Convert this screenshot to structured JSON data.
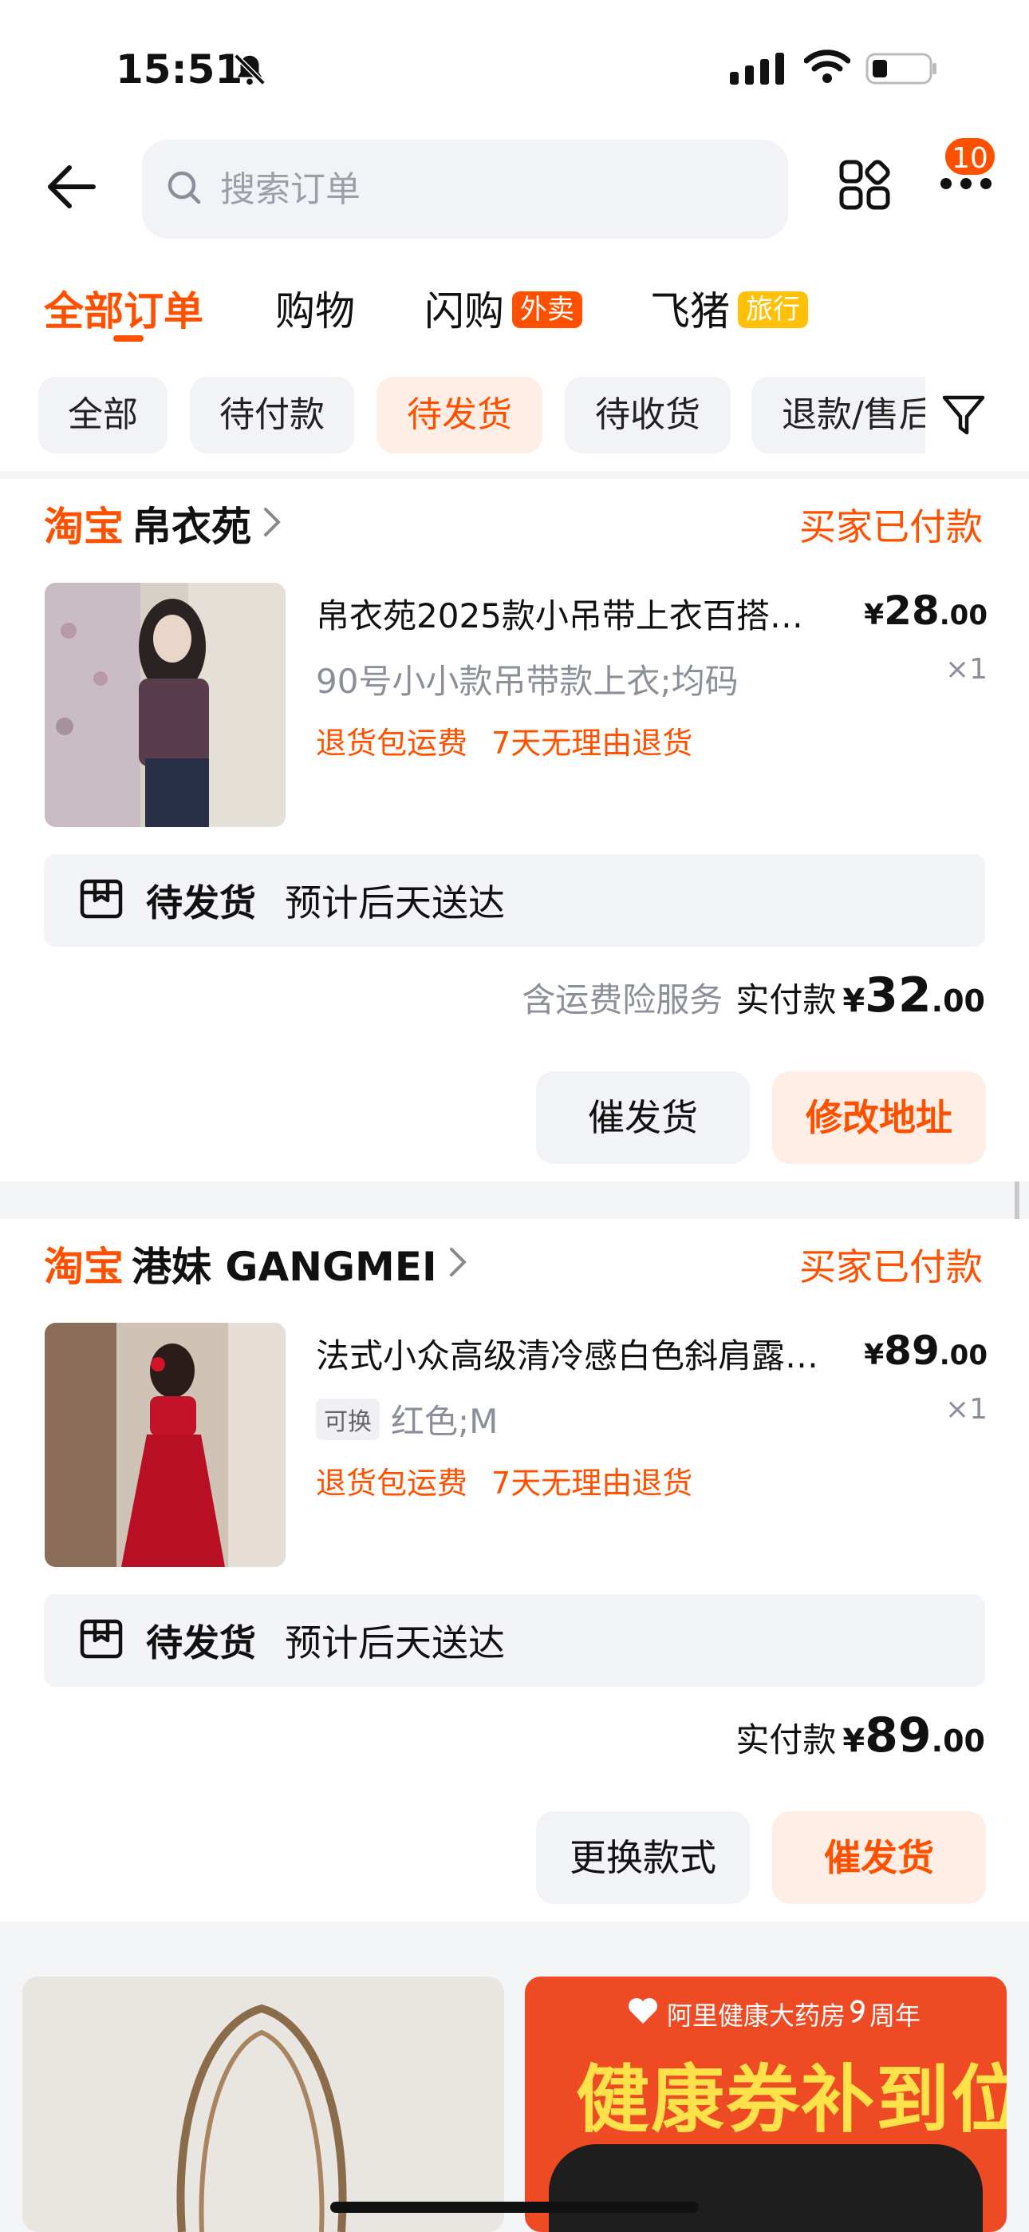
{
  "status_bar": {
    "time": "15:51"
  },
  "search": {
    "placeholder": "搜索订单"
  },
  "header": {
    "badge_count": "10"
  },
  "tabs": [
    {
      "label": "全部订单",
      "tag": ""
    },
    {
      "label": "购物",
      "tag": ""
    },
    {
      "label": "闪购",
      "tag": "外卖"
    },
    {
      "label": "飞猪",
      "tag": "旅行"
    }
  ],
  "filters": [
    "全部",
    "待付款",
    "待发货",
    "待收货",
    "退款/售后"
  ],
  "orders": [
    {
      "brand": "淘宝",
      "shop": "帛衣苑",
      "status": "买家已付款",
      "title": "帛衣苑2025款小吊带上衣百搭…",
      "price_currency": "¥",
      "price_int": "28",
      "price_dec": ".00",
      "tag": "",
      "spec": "90号小小款吊带款上衣;均码",
      "qty": "×1",
      "promos": [
        "退货包运费",
        "7天无理由退货"
      ],
      "ship_status": "待发货",
      "ship_eta": "预计后天送达",
      "insurance": "含运费险服务",
      "paid_label": "实付款",
      "paid_currency": "¥",
      "paid_int": "32",
      "paid_dec": ".00",
      "btn1": "催发货",
      "btn2": "修改地址"
    },
    {
      "brand": "淘宝",
      "shop": "港妹 GANGMEI",
      "status": "买家已付款",
      "title": "法式小众高级清冷感白色斜肩露…",
      "price_currency": "¥",
      "price_int": "89",
      "price_dec": ".00",
      "tag": "可换",
      "spec": "红色;M",
      "qty": "×1",
      "promos": [
        "退货包运费",
        "7天无理由退货"
      ],
      "ship_status": "待发货",
      "ship_eta": "预计后天送达",
      "insurance": "",
      "paid_label": "实付款",
      "paid_currency": "¥",
      "paid_int": "89",
      "paid_dec": ".00",
      "btn1": "更换款式",
      "btn2": "催发货"
    }
  ],
  "recommend": {
    "ad_brand": "阿里健康大药房",
    "ad_anniv": "周年",
    "ad_headline": "健康券补到位"
  },
  "colors": {
    "accent": "#ff5000",
    "tag_yellow": "#ffc107"
  }
}
